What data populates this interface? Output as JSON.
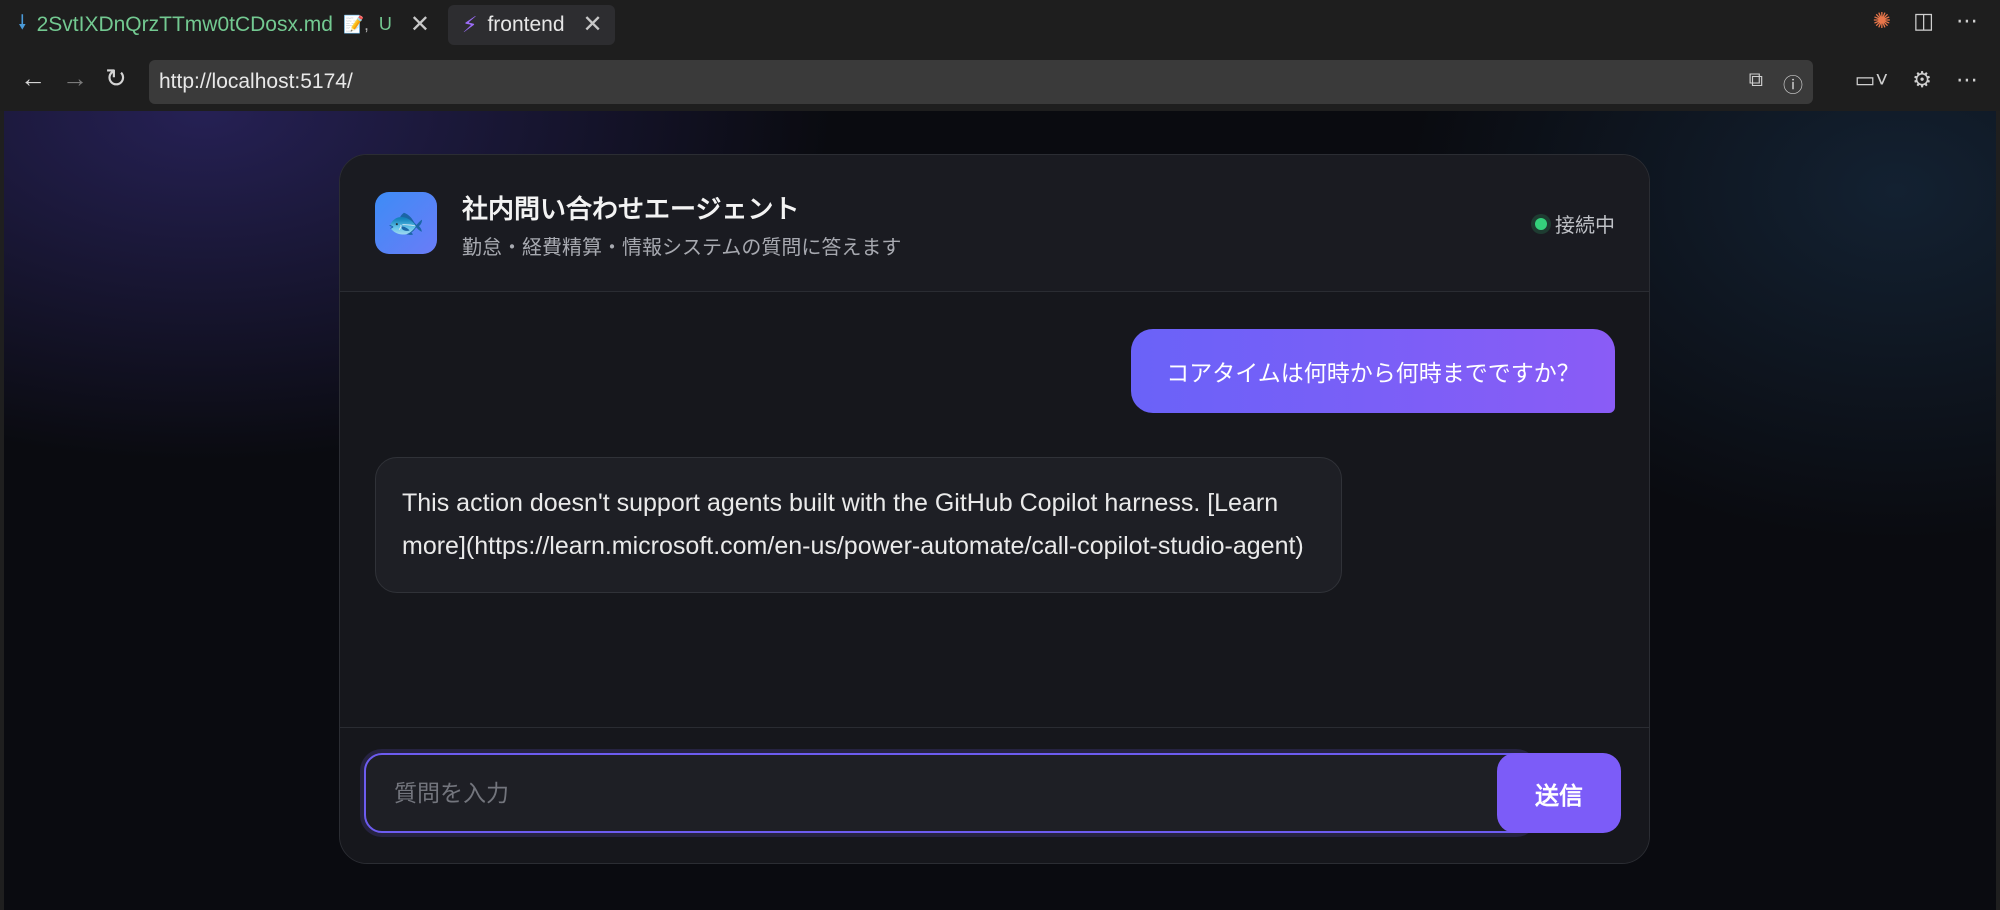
{
  "tabs": [
    {
      "label": "2SvtIXDnQrzTTmw0tCDosx.md",
      "modified_marker": "📝,",
      "git_status": "U",
      "icon": "download-arrow-icon"
    },
    {
      "label": "frontend",
      "icon": "lightning-icon"
    }
  ],
  "address": {
    "url": "http://localhost:5174/"
  },
  "app": {
    "title": "社内問い合わせエージェント",
    "subtitle": "勤怠・経費精算・情報システムの質問に答えます",
    "status": "接続中",
    "icon": "🐟"
  },
  "messages": {
    "user": "コアタイムは何時から何時までですか？",
    "bot": "This action doesn't support agents built with the GitHub Copilot harness. [Learn more](https://learn.microsoft.com/en-us/power-automate/call-copilot-studio-agent)"
  },
  "composer": {
    "placeholder": "質問を入力",
    "send_label": "送信"
  },
  "colors": {
    "accent": "#7c5cf8",
    "status_green": "#34d17b"
  }
}
